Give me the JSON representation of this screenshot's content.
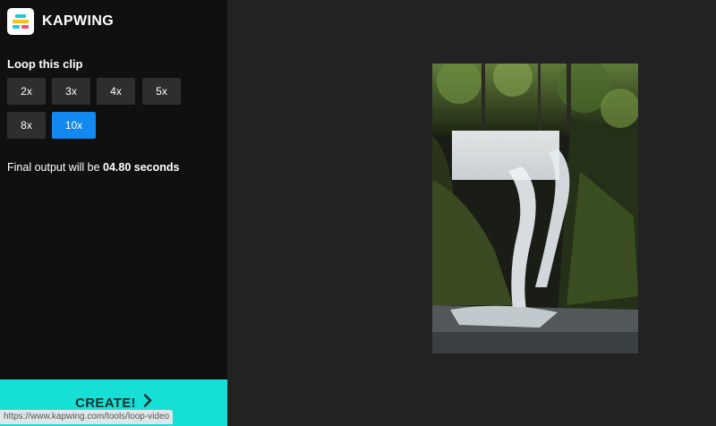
{
  "app": {
    "name": "KAPWING"
  },
  "loop": {
    "title": "Loop this clip",
    "options": [
      {
        "label": "2x",
        "selected": false
      },
      {
        "label": "3x",
        "selected": false
      },
      {
        "label": "4x",
        "selected": false
      },
      {
        "label": "5x",
        "selected": false
      },
      {
        "label": "8x",
        "selected": false
      },
      {
        "label": "10x",
        "selected": true
      }
    ]
  },
  "output": {
    "prefix": "Final output will be ",
    "duration": "04.80 seconds"
  },
  "create": {
    "label": "CREATE!"
  },
  "statusbar": {
    "url": "https://www.kapwing.com/tools/loop-video"
  },
  "colors": {
    "accent": "#1289ee",
    "create": "#16e0d6",
    "sidebar": "#101010",
    "canvas": "#222222"
  },
  "preview": {
    "subject": "waterfall-video-preview"
  }
}
